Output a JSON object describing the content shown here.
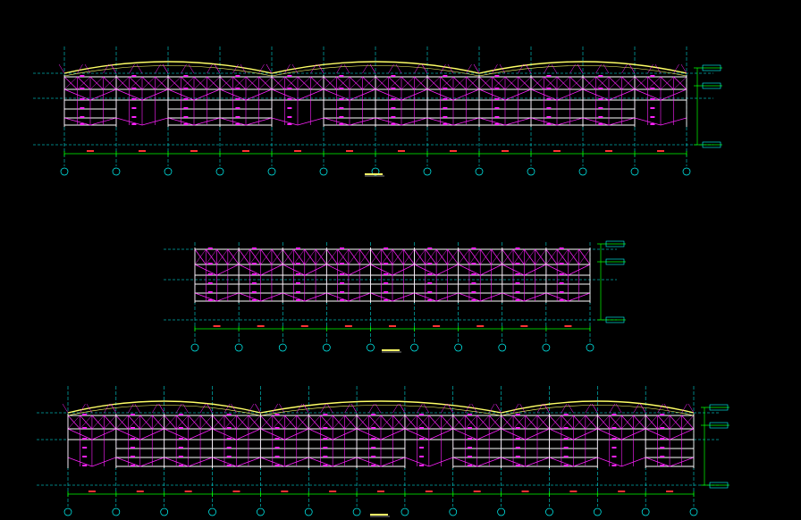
{
  "viewer": {
    "background": "#000000",
    "colors": {
      "structure": "#ff22ff",
      "chord": "#ffffff",
      "roof": "#ffff66",
      "grid": "#00ffff",
      "dimension": "#00ff00"
    }
  },
  "drawings": [
    {
      "id": "elevation-1",
      "columns": 13,
      "grid_labels": [
        "",
        "",
        "",
        "",
        "",
        "",
        "",
        "",
        "",
        "",
        "",
        "",
        ""
      ],
      "level_tags": [
        "",
        "",
        ""
      ]
    },
    {
      "id": "elevation-2",
      "columns": 10,
      "grid_labels": [
        "",
        "",
        "",
        "",
        "",
        "",
        "",
        "",
        "",
        ""
      ],
      "level_tags": [
        "",
        "",
        ""
      ]
    },
    {
      "id": "elevation-3",
      "columns": 14,
      "grid_labels": [
        "",
        "",
        "",
        "",
        "",
        "",
        "",
        "",
        "",
        "",
        "",
        "",
        "",
        ""
      ],
      "level_tags": [
        "",
        "",
        ""
      ]
    }
  ]
}
